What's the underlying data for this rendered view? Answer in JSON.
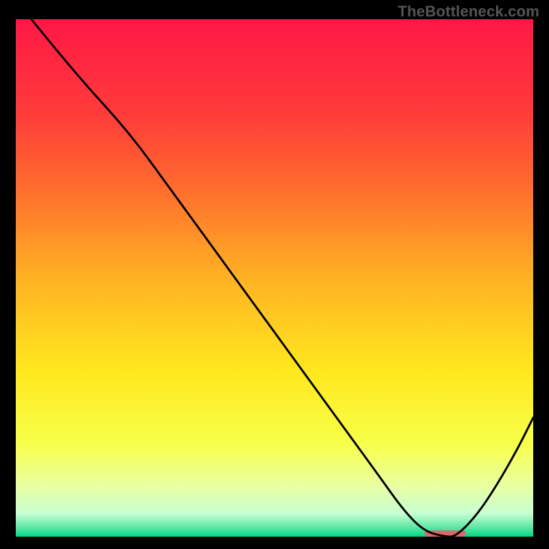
{
  "watermark": "TheBottleneck.com",
  "chart_data": {
    "type": "line",
    "title": "",
    "xlabel": "",
    "ylabel": "",
    "xlim": [
      0,
      100
    ],
    "ylim": [
      0,
      100
    ],
    "background_gradient": {
      "stops": [
        {
          "offset": 0.0,
          "color": "#ff1846"
        },
        {
          "offset": 0.18,
          "color": "#ff3b3b"
        },
        {
          "offset": 0.32,
          "color": "#ff6a2e"
        },
        {
          "offset": 0.5,
          "color": "#ffb224"
        },
        {
          "offset": 0.68,
          "color": "#ffe81e"
        },
        {
          "offset": 0.82,
          "color": "#f7ff4a"
        },
        {
          "offset": 0.9,
          "color": "#eaffa0"
        },
        {
          "offset": 0.955,
          "color": "#c8ffd2"
        },
        {
          "offset": 0.98,
          "color": "#66e8a8"
        },
        {
          "offset": 1.0,
          "color": "#00d884"
        }
      ]
    },
    "curve": {
      "x": [
        3,
        12,
        22,
        30,
        38,
        46,
        54,
        62,
        70,
        75,
        79,
        83,
        85,
        89,
        93,
        97,
        100
      ],
      "y": [
        100,
        89,
        78,
        67,
        56,
        45,
        34,
        23,
        12,
        5,
        1,
        0,
        0,
        4,
        10,
        17,
        23
      ]
    },
    "marker": {
      "x_center": 83,
      "y": 0,
      "width": 8,
      "height": 1.2,
      "color": "#d86a6a"
    }
  }
}
